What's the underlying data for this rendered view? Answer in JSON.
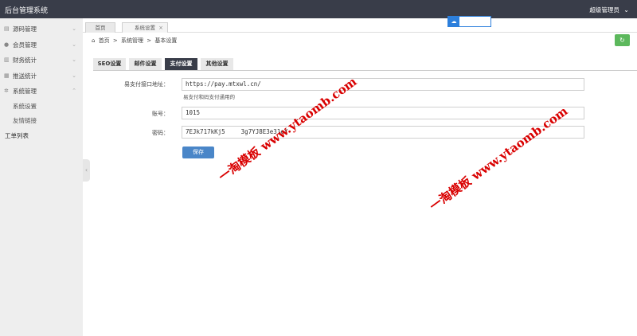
{
  "app": {
    "title": "后台管理系统",
    "user": "超级管理员"
  },
  "sidebar": {
    "items": [
      {
        "label": "源码管理",
        "icon": "bars-icon"
      },
      {
        "label": "会员管理",
        "icon": "user-icon"
      },
      {
        "label": "财务统计",
        "icon": "stats-icon"
      },
      {
        "label": "推送统计",
        "icon": "send-icon"
      },
      {
        "label": "系统管理",
        "icon": "gear-icon"
      }
    ],
    "subitems": [
      "系统设置",
      "友情链接"
    ],
    "extra": "工单列表"
  },
  "tabs": {
    "home": "首页",
    "system": "系统设置"
  },
  "breadcrumb": {
    "home": "首页",
    "sep": ">",
    "level1": "系统管理",
    "level2": "基本设置"
  },
  "formtabs": [
    "SEO设置",
    "邮件设置",
    "支付设置",
    "其他设置"
  ],
  "form": {
    "api_label": "易支付接口地址：",
    "api_value": "https://pay.mtxwl.cn/",
    "api_hint": "易支付和码支付通用的",
    "account_label": "账号：",
    "account_value": "1015",
    "password_label": "密码：",
    "password_value": "7EJk717kKj5",
    "password_value_tail": "3g7YJ8E3e31eY",
    "submit": "保存"
  },
  "watermark": "一淘模板 www.ytaomb.com",
  "colors": {
    "topbar": "#393d49",
    "sidebar": "#eeeeee",
    "active_tab": "#393d49",
    "submit": "#4a86c8",
    "refresh": "#5cb85c",
    "watermark": "#d90000"
  }
}
